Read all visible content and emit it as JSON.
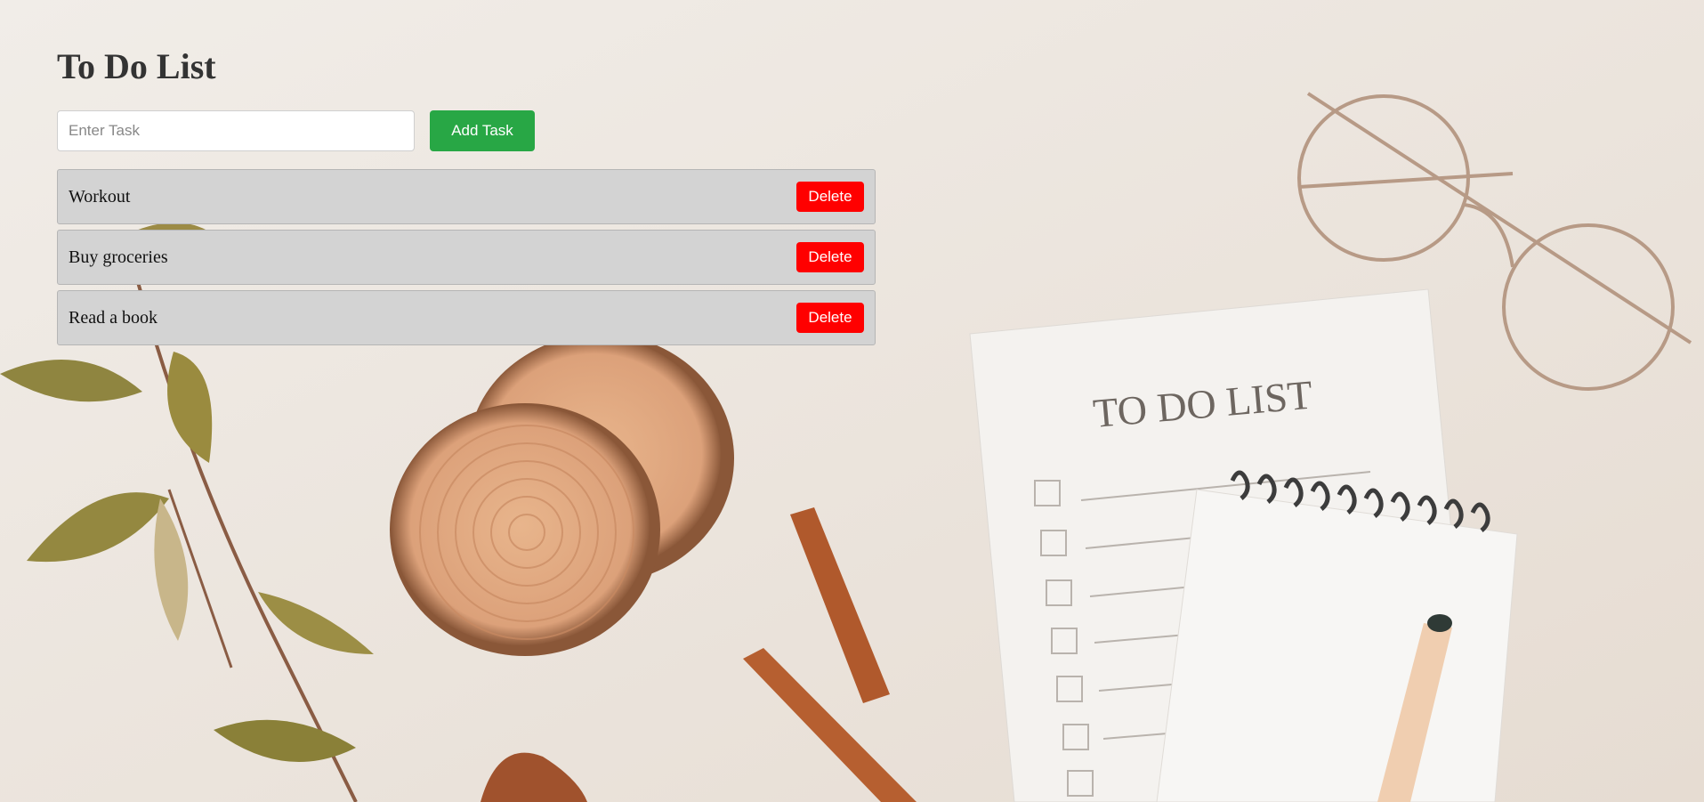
{
  "app": {
    "title": "To Do List",
    "input": {
      "placeholder": "Enter Task",
      "value": ""
    },
    "add_button_label": "Add Task",
    "delete_label": "Delete",
    "tasks": [
      {
        "name": "Workout"
      },
      {
        "name": "Buy groceries"
      },
      {
        "name": "Read a book"
      }
    ]
  },
  "background": {
    "description_icon": "desk-flatlay-photo",
    "notepad_heading": "TO DO LIST"
  },
  "colors": {
    "add_button": "#28a745",
    "delete_button": "#ff0000",
    "task_background": "#d3d3d3"
  }
}
